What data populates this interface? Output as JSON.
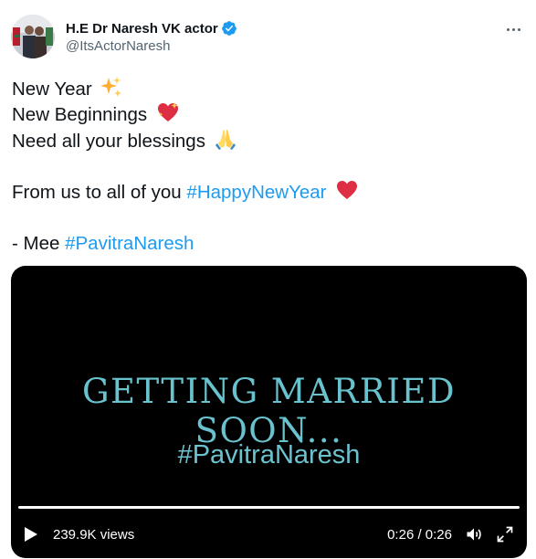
{
  "user": {
    "display_name": "H.E Dr Naresh VK actor",
    "handle": "@ItsActorNaresh",
    "verified": true,
    "avatar": "profile-photo"
  },
  "tweet": {
    "lines": [
      {
        "text": "New Year",
        "emoji": "sparkles"
      },
      {
        "text": "New Beginnings",
        "emoji": "sparkling-heart"
      },
      {
        "text": "Need all your blessings",
        "emoji": "folded-hands"
      }
    ],
    "line4_prefix": "From us to all of you",
    "line4_hashtag": "#HappyNewYear",
    "line4_emoji": "red-heart",
    "line5_prefix": "- Mee",
    "line5_hashtag": "#PavitraNaresh"
  },
  "video": {
    "caption_main": "GETTING MARRIED SOON...",
    "caption_tag": "#PavitraNaresh",
    "views": "239.9K views",
    "time": "0:26 / 0:26",
    "progress": 1.0
  },
  "colors": {
    "accent": "#1d9bf0",
    "text": "#0f1419",
    "secondary": "#536471",
    "caption": "#69c3cf"
  }
}
